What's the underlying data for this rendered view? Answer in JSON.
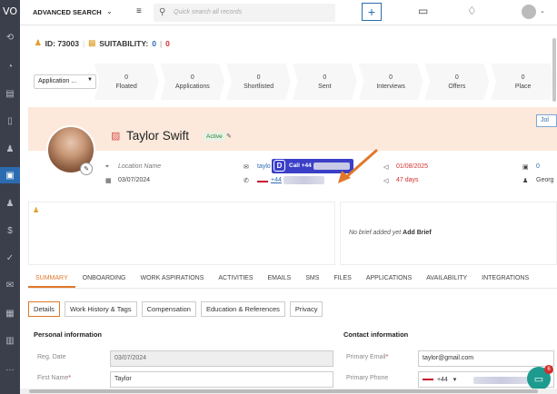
{
  "sidebar": {
    "logo": "VO",
    "items": [
      {
        "icon": "history-icon",
        "glyph": "⟲"
      },
      {
        "icon": "dashboard-icon",
        "glyph": "◔"
      },
      {
        "icon": "clipboard-icon",
        "glyph": "▤"
      },
      {
        "icon": "document-icon",
        "glyph": "▯"
      },
      {
        "icon": "people-icon",
        "glyph": "♟"
      },
      {
        "icon": "briefcase-icon",
        "glyph": "▣"
      },
      {
        "icon": "person-icon",
        "glyph": "♟"
      },
      {
        "icon": "dollar-icon",
        "glyph": "$"
      },
      {
        "icon": "check-circle-icon",
        "glyph": "✓"
      },
      {
        "icon": "mail-icon",
        "glyph": "✉"
      },
      {
        "icon": "calendar-icon",
        "glyph": "▦"
      },
      {
        "icon": "chart-icon",
        "glyph": "▥"
      },
      {
        "icon": "more-icon",
        "glyph": "…"
      }
    ]
  },
  "topbar": {
    "advanced_search": "ADVANCED SEARCH",
    "search_placeholder": "Quick search all records",
    "plus": "+"
  },
  "record": {
    "id_label": "ID: 73003",
    "separator": "|",
    "suitability_label": "SUITABILITY:",
    "suit_a": "0",
    "suit_sep": "|",
    "suit_b": "0"
  },
  "pipeline": {
    "selector": "Application ...",
    "stages": [
      {
        "count": "0",
        "label": "Floated"
      },
      {
        "count": "0",
        "label": "Applications"
      },
      {
        "count": "0",
        "label": "Shortlisted"
      },
      {
        "count": "0",
        "label": "Sent"
      },
      {
        "count": "0",
        "label": "Interviews"
      },
      {
        "count": "0",
        "label": "Offers"
      },
      {
        "count": "0",
        "label": "Place"
      }
    ]
  },
  "profile": {
    "name": "Taylor Swift",
    "status": "Active",
    "job_button": "Jol",
    "location": "Location Name",
    "date": "03/07/2024",
    "email_partial": "taylo",
    "phone_partial": "+44",
    "call_label": "Call +44",
    "date_red": "01/08/2025",
    "days": "47 days",
    "right_count": "0",
    "right_text": "Georg"
  },
  "brief": {
    "text": "No brief added yet",
    "link": "Add Brief"
  },
  "tabs": [
    "SUMMARY",
    "ONBOARDING",
    "WORK ASPIRATIONS",
    "ACTIVITIES",
    "EMAILS",
    "SMS",
    "FILES",
    "APPLICATIONS",
    "AVAILABILITY",
    "INTEGRATIONS"
  ],
  "subtabs": [
    "Details",
    "Work History & Tags",
    "Compensation",
    "Education & References",
    "Privacy"
  ],
  "personal": {
    "title": "Personal information",
    "reg_label": "Reg. Date",
    "reg_value": "03/07/2024",
    "first_label": "First Name",
    "first_value": "Taylor",
    "req": "*"
  },
  "contact": {
    "title": "Contact information",
    "email_label": "Primary Email",
    "email_value": "taylor@gmail.com",
    "phone_label": "Primary Phone",
    "phone_code": "+44",
    "req": "*"
  },
  "chat": {
    "badge": "6"
  },
  "colors": {
    "accent": "#e0782b",
    "primary": "#2b6cb0",
    "sidebar": "#3a3f4b",
    "profile_bg": "#fde9dc"
  }
}
